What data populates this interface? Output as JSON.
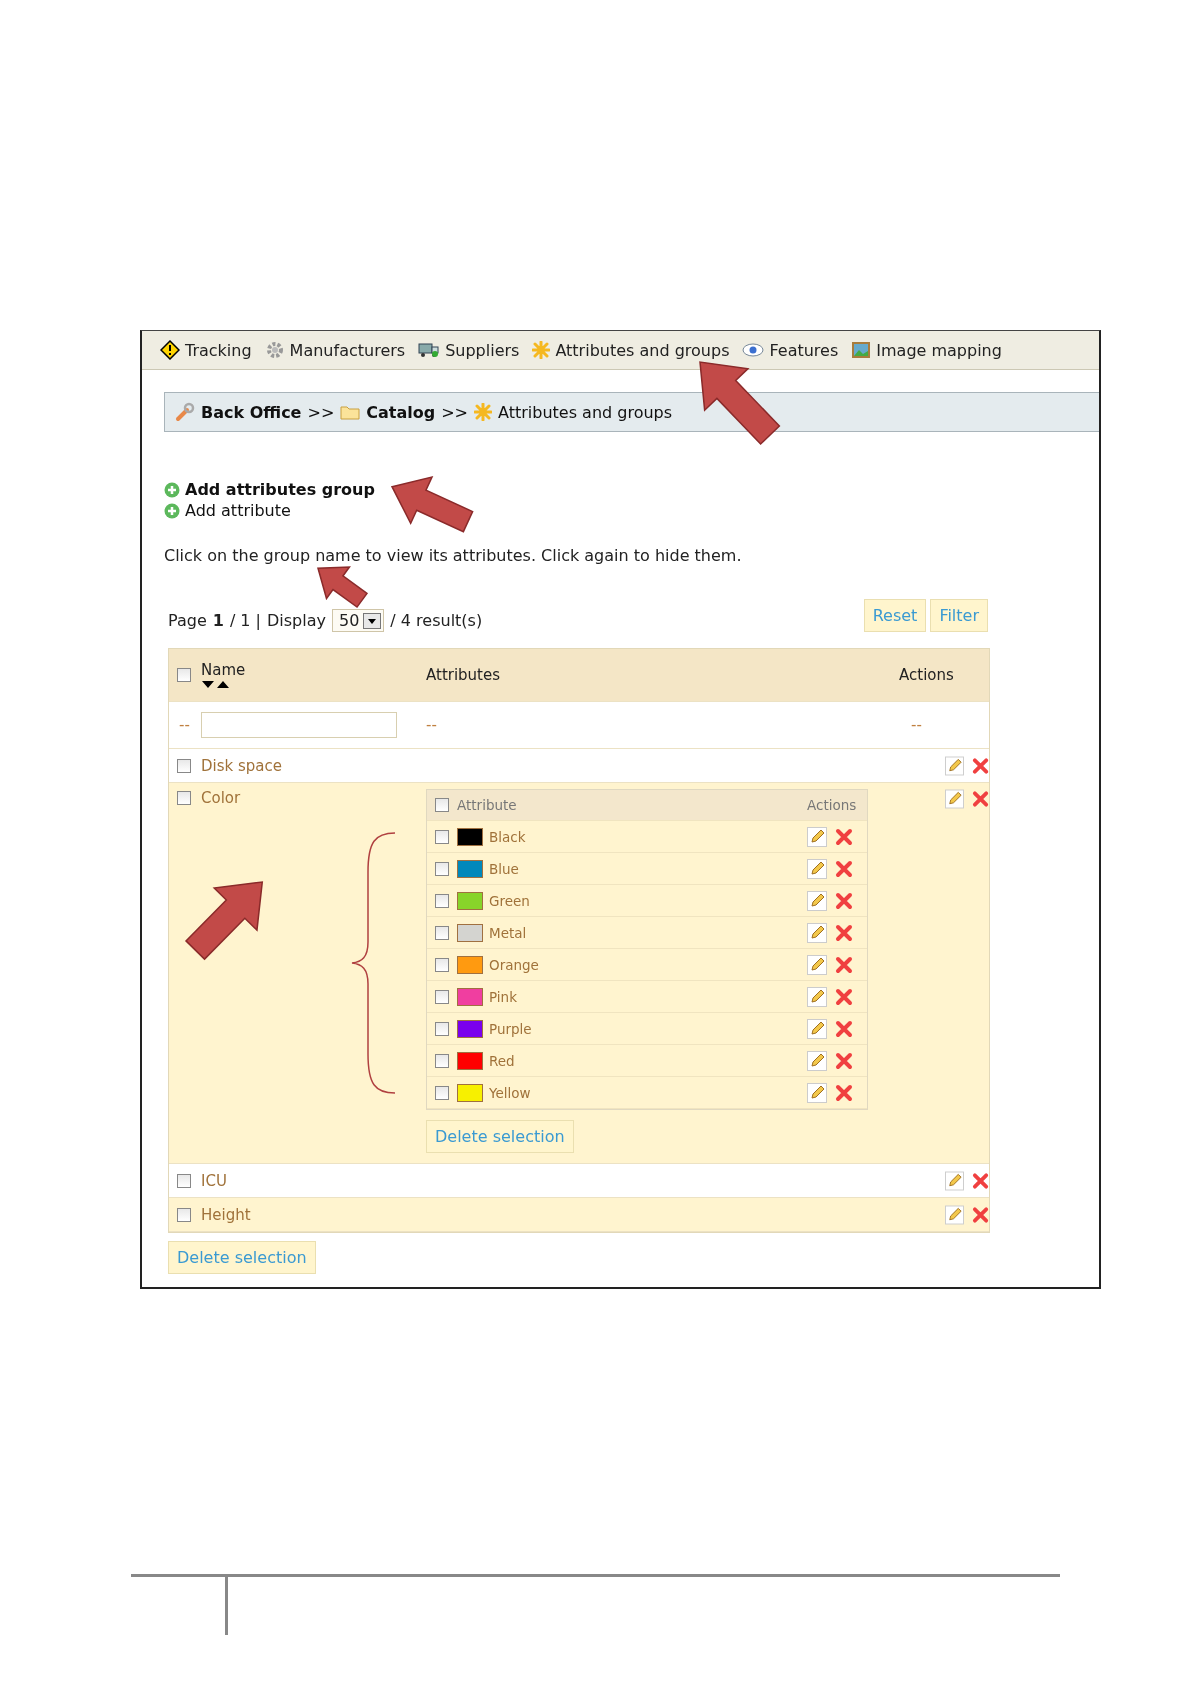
{
  "nav": [
    {
      "label": "Tracking"
    },
    {
      "label": "Manufacturers"
    },
    {
      "label": "Suppliers"
    },
    {
      "label": "Attributes and groups"
    },
    {
      "label": "Features"
    },
    {
      "label": "Image mapping"
    }
  ],
  "breadcrumb": {
    "items": [
      {
        "label": "Back Office",
        "kind": "root"
      },
      {
        "label": "Catalog",
        "kind": "folder"
      },
      {
        "label": "Attributes and groups",
        "kind": "current"
      }
    ],
    "separators": [
      ">>",
      ">>"
    ]
  },
  "links": [
    {
      "label": "Add attributes group",
      "kind": "primary"
    },
    {
      "label": "Add attribute",
      "kind": "secondary"
    }
  ],
  "hint": "Click on the group name to view its attributes. Click again to hide them.",
  "pager": {
    "page_label": "Page",
    "page": "1",
    "total": "/ 1 |",
    "display_label": "Display",
    "per_page": "50",
    "results": "/ 4 result(s)"
  },
  "filter_buttons": [
    "Reset",
    "Filter"
  ],
  "table": {
    "select_all": {
      "checked": false
    },
    "columns": [
      "Name",
      "Attributes",
      "Actions"
    ],
    "filter_row": [
      "--",
      "--",
      "--"
    ],
    "groups": [
      {
        "name": "Disk space",
        "checked": false,
        "expanded": false
      },
      {
        "name": "Color",
        "checked": false,
        "expanded": true,
        "attributes": {
          "select_all": {
            "checked": false
          },
          "columns": [
            "Attribute",
            "Actions"
          ],
          "rows": [
            {
              "name": "Black",
              "color": "#000000",
              "checked": false
            },
            {
              "name": "Blue",
              "color": "#0088bb",
              "checked": false
            },
            {
              "name": "Green",
              "color": "#88d42a",
              "checked": false
            },
            {
              "name": "Metal",
              "color": "#d4d4d0",
              "checked": false
            },
            {
              "name": "Orange",
              "color": "#ff9a10",
              "checked": false
            },
            {
              "name": "Pink",
              "color": "#f03ea0",
              "checked": false
            },
            {
              "name": "Purple",
              "color": "#7a00ee",
              "checked": false
            },
            {
              "name": "Red",
              "color": "#ff0000",
              "checked": false
            },
            {
              "name": "Yellow",
              "color": "#f7f000",
              "checked": false
            }
          ],
          "button": "Delete selection"
        }
      },
      {
        "name": "ICU",
        "checked": false,
        "expanded": false
      },
      {
        "name": "Height",
        "checked": false,
        "expanded": false
      }
    ]
  },
  "bottom_button": "Delete selection"
}
